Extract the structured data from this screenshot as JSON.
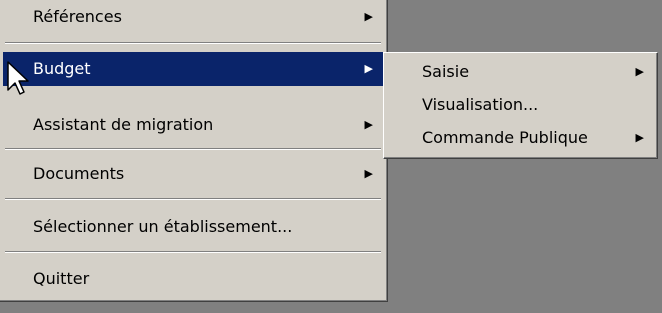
{
  "main_menu": {
    "items": [
      {
        "label": "Références",
        "has_submenu": true
      },
      {
        "label": "Budget",
        "has_submenu": true,
        "selected": true
      },
      {
        "label": "Assistant de migration",
        "has_submenu": true
      },
      {
        "label": "Documents",
        "has_submenu": true
      },
      {
        "label": "Sélectionner un établissement...",
        "has_submenu": false
      },
      {
        "label": "Quitter",
        "has_submenu": false
      }
    ]
  },
  "submenu": {
    "items": [
      {
        "label": "Saisie",
        "has_submenu": true
      },
      {
        "label": "Visualisation...",
        "has_submenu": false
      },
      {
        "label": "Commande Publique",
        "has_submenu": true
      }
    ]
  },
  "icons": {
    "submenu_arrow": "triangle-right-icon",
    "cursor": "arrow-cursor-icon"
  },
  "colors": {
    "menu_background": "#d4d0c8",
    "selection_background": "#0a246a",
    "selection_text": "#ffffff",
    "desktop_background": "#808080"
  }
}
